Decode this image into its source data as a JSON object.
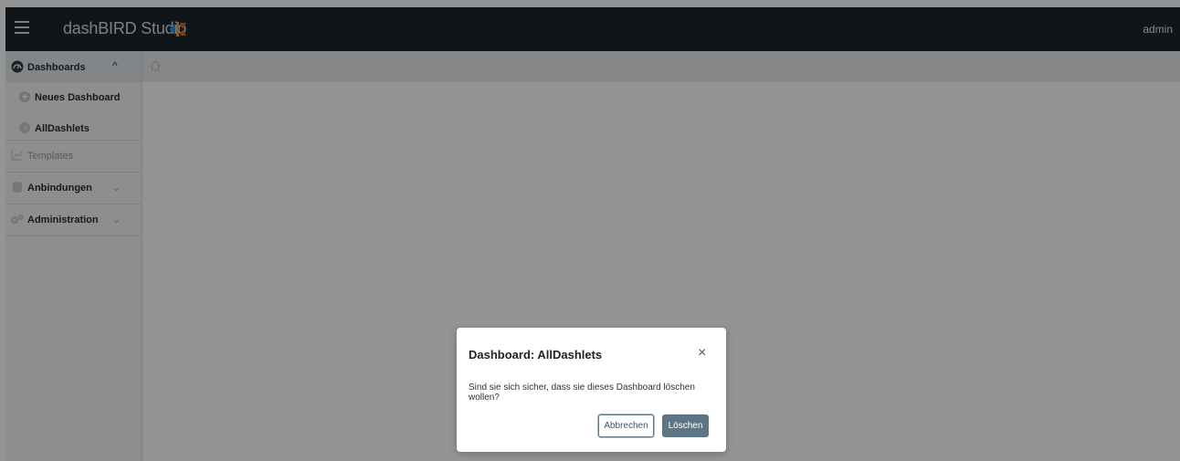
{
  "header": {
    "app_name": "dashBIRD Studio",
    "user": "admin"
  },
  "sidebar": {
    "dashboards": {
      "label": "Dashboards",
      "expanded": true
    },
    "items": [
      {
        "label": "Neues Dashboard",
        "icon": "plus-circle-icon"
      },
      {
        "label": "AllDashlets",
        "icon": "dashboard-gauge-icon"
      }
    ],
    "templates": {
      "label": "Templates",
      "icon": "chart-icon"
    },
    "anbindungen": {
      "label": "Anbindungen",
      "icon": "database-icon"
    },
    "administration": {
      "label": "Administration",
      "icon": "gears-icon"
    }
  },
  "dialog": {
    "title": "Dashboard: AllDashlets",
    "message": "Sind sie sich sicher, dass sie dieses Dashboard löschen wollen?",
    "cancel_label": "Abbrechen",
    "delete_label": "Löschen",
    "close_symbol": "×"
  },
  "colors": {
    "topbar": "#1b252b",
    "primary_button": "#5d7683",
    "overlay": "rgba(0,0,0,0.42)"
  }
}
